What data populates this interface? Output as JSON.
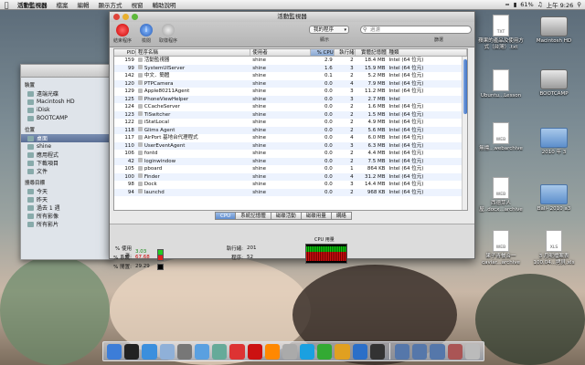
{
  "menubar": {
    "apple": "",
    "app_name": "活動監視器",
    "items": [
      "檔案",
      "編輯",
      "顯示方式",
      "視窗",
      "輔助說明"
    ],
    "battery": "61%",
    "clock": "上午 9:26",
    "volume_icon": "volume-icon",
    "wifi_icon": "wifi-icon",
    "spotlight_icon": "spotlight-icon"
  },
  "finder": {
    "sections": [
      {
        "title": "裝置",
        "items": [
          {
            "label": "遠端光碟",
            "selected": false
          },
          {
            "label": "Macintosh HD",
            "selected": false
          },
          {
            "label": "iDisk",
            "selected": false
          },
          {
            "label": "BOOTCAMP",
            "selected": false
          }
        ]
      },
      {
        "title": "位置",
        "items": [
          {
            "label": "桌面",
            "selected": true
          },
          {
            "label": "shine",
            "selected": false
          },
          {
            "label": "應用程式",
            "selected": false
          },
          {
            "label": "下載項目",
            "selected": false
          },
          {
            "label": "文件",
            "selected": false
          }
        ]
      },
      {
        "title": "搜尋目標",
        "items": [
          {
            "label": "今天",
            "selected": false
          },
          {
            "label": "昨天",
            "selected": false
          },
          {
            "label": "過去 1 週",
            "selected": false
          },
          {
            "label": "所有影像",
            "selected": false
          },
          {
            "label": "所有影片",
            "selected": false
          }
        ]
      }
    ]
  },
  "activity_monitor": {
    "title": "活動監視器",
    "toolbar": {
      "quit_label": "結束程序",
      "inspect_label": "檢閱",
      "sample_label": "取樣程序",
      "filter_value": "我的程序",
      "search_placeholder": "過濾",
      "show_label": "顯示",
      "filter_label": "篩選"
    },
    "columns": [
      "PID",
      "程序名稱",
      "使用者",
      "% CPU",
      "執行緒",
      "實體記憶體",
      "種類"
    ],
    "rows": [
      {
        "pid": "159",
        "name": "活動監視器",
        "user": "shine",
        "cpu": "2.9",
        "threads": "2",
        "mem": "18.4 MB",
        "kind": "Intel (64 位元)"
      },
      {
        "pid": "99",
        "name": "SystemUIServer",
        "user": "shine",
        "cpu": "1.6",
        "threads": "3",
        "mem": "15.9 MB",
        "kind": "Intel (64 位元)"
      },
      {
        "pid": "142",
        "name": "中文．簡體",
        "user": "shine",
        "cpu": "0.1",
        "threads": "2",
        "mem": "5.2 MB",
        "kind": "Intel (64 位元)"
      },
      {
        "pid": "120",
        "name": "PTPCamera",
        "user": "shine",
        "cpu": "0.0",
        "threads": "4",
        "mem": "7.9 MB",
        "kind": "Intel (64 位元)"
      },
      {
        "pid": "129",
        "name": "Apple80211Agent",
        "user": "shine",
        "cpu": "0.0",
        "threads": "3",
        "mem": "11.2 MB",
        "kind": "Intel (64 位元)"
      },
      {
        "pid": "125",
        "name": "PhoneViewHelper",
        "user": "shine",
        "cpu": "0.0",
        "threads": "3",
        "mem": "2.7 MB",
        "kind": "Intel"
      },
      {
        "pid": "124",
        "name": "CCacheServer",
        "user": "shine",
        "cpu": "0.0",
        "threads": "2",
        "mem": "1.6 MB",
        "kind": "Intel (64 位元)"
      },
      {
        "pid": "123",
        "name": "TiSwitcher",
        "user": "shine",
        "cpu": "0.0",
        "threads": "2",
        "mem": "1.5 MB",
        "kind": "Intel (64 位元)"
      },
      {
        "pid": "122",
        "name": "iStatLocal",
        "user": "shine",
        "cpu": "0.0",
        "threads": "2",
        "mem": "4.9 MB",
        "kind": "Intel (64 位元)"
      },
      {
        "pid": "118",
        "name": "Glims Agent",
        "user": "shine",
        "cpu": "0.0",
        "threads": "2",
        "mem": "5.6 MB",
        "kind": "Intel (64 位元)"
      },
      {
        "pid": "117",
        "name": "AirPort 基地台代理程式",
        "user": "shine",
        "cpu": "0.0",
        "threads": "4",
        "mem": "6.0 MB",
        "kind": "Intel (64 位元)"
      },
      {
        "pid": "110",
        "name": "UserEventAgent",
        "user": "shine",
        "cpu": "0.0",
        "threads": "3",
        "mem": "6.3 MB",
        "kind": "Intel (64 位元)"
      },
      {
        "pid": "106",
        "name": "fontd",
        "user": "shine",
        "cpu": "0.0",
        "threads": "2",
        "mem": "4.4 MB",
        "kind": "Intel (64 位元)"
      },
      {
        "pid": "42",
        "name": "loginwindow",
        "user": "shine",
        "cpu": "0.0",
        "threads": "2",
        "mem": "7.5 MB",
        "kind": "Intel (64 位元)"
      },
      {
        "pid": "105",
        "name": "pboard",
        "user": "shine",
        "cpu": "0.0",
        "threads": "1",
        "mem": "864 KB",
        "kind": "Intel (64 位元)"
      },
      {
        "pid": "100",
        "name": "Finder",
        "user": "shine",
        "cpu": "0.0",
        "threads": "4",
        "mem": "31.2 MB",
        "kind": "Intel (64 位元)"
      },
      {
        "pid": "98",
        "name": "Dock",
        "user": "shine",
        "cpu": "0.0",
        "threads": "3",
        "mem": "14.4 MB",
        "kind": "Intel (64 位元)"
      },
      {
        "pid": "94",
        "name": "launchd",
        "user": "shine",
        "cpu": "0.0",
        "threads": "2",
        "mem": "968 KB",
        "kind": "Intel (64 位元)"
      }
    ],
    "tabs": [
      "CPU",
      "系統記憶體",
      "磁碟活動",
      "磁碟用量",
      "網絡"
    ],
    "active_tab": "CPU",
    "stats": {
      "user_label": "% 使用者:",
      "user_value": "3.03",
      "user_color": "#22cc22",
      "system_label": "% 系統:",
      "system_value": "67.68",
      "system_color": "#dd2222",
      "idle_label": "% 閒置:",
      "idle_value": "29.29",
      "idle_color": "#000000",
      "threads_label": "執行緒:",
      "threads_value": "201",
      "procs_label": "程序:",
      "procs_value": "52",
      "graph_label": "CPU 用量"
    }
  },
  "desktop_icons": [
    {
      "label": "TXT",
      "caption": "蘋果的產品及使用方式（台灣）.txt"
    },
    {
      "label": "",
      "caption": "Macintosh HD"
    },
    {
      "label": "",
      "caption": "Ubuntu...Lesson"
    },
    {
      "label": "",
      "caption": "BOOTCAMP"
    },
    {
      "label": "WEB",
      "caption": "無標...webarchive"
    },
    {
      "label": "",
      "caption": "2010 年 3"
    },
    {
      "label": "WEB",
      "caption": "西德芽人屋..docx...archive"
    },
    {
      "label": "",
      "caption": "Ball- 2010 a3"
    },
    {
      "label": "WEB",
      "caption": "果子青餐合一caviar...archive"
    },
    {
      "label": "XLS",
      "caption": "3 月呢檔案表100.04...拷貝.xls"
    }
  ],
  "dock": {
    "icons": [
      "finder-icon",
      "dashboard-icon",
      "safari-icon",
      "mail-icon",
      "preferences-icon",
      "itunes-icon",
      "photo-icon",
      "calendar-icon",
      "acrobat-icon",
      "vlc-icon",
      "transmission-icon",
      "skype-icon",
      "dreamweaver-icon",
      "fireworks-icon",
      "photoshop-icon",
      "activity-monitor-icon",
      "applications-folder-icon",
      "downloads-folder-icon",
      "documents-folder-icon",
      "photos-stack-icon",
      "trash-icon"
    ]
  }
}
